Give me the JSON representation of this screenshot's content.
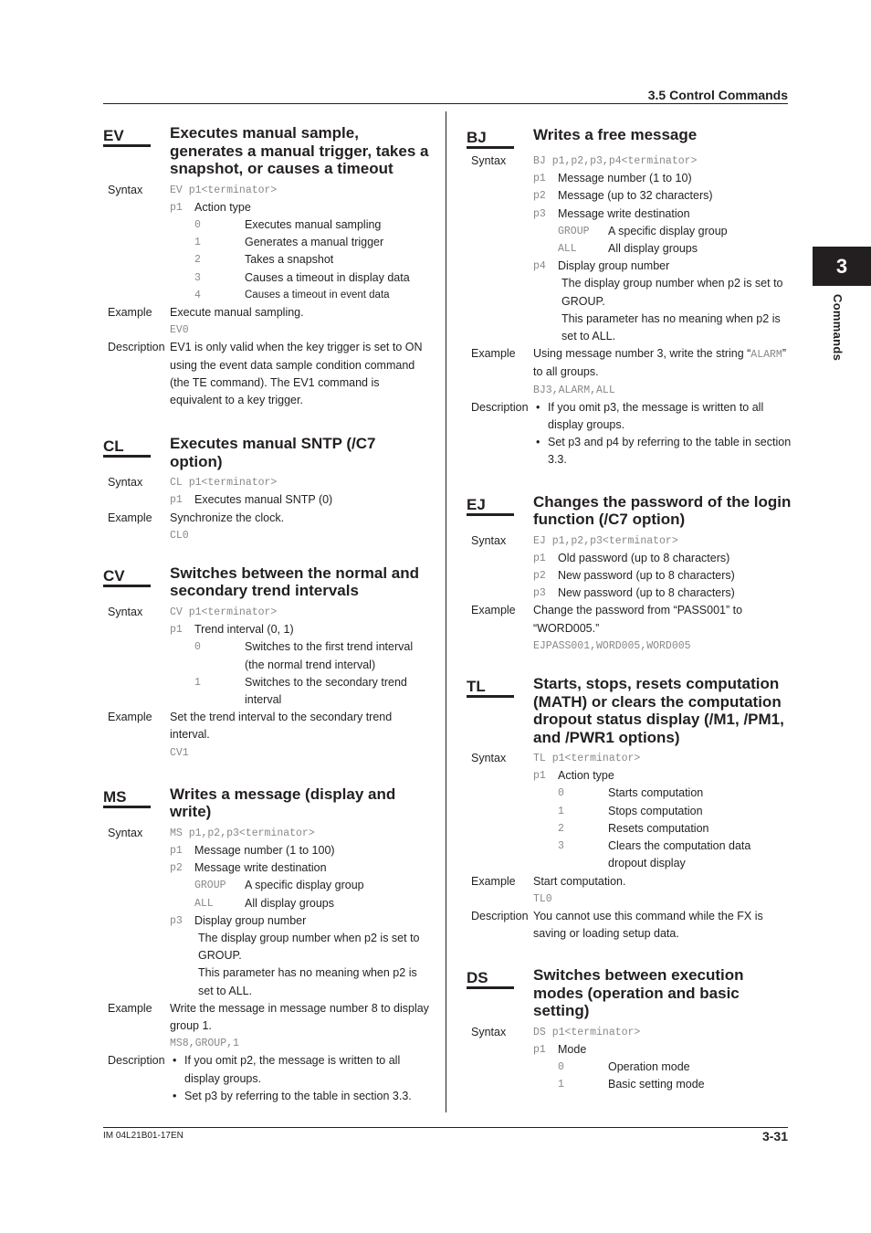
{
  "header": {
    "section_title": "3.5  Control Commands"
  },
  "chapter_tab": {
    "number": "3",
    "label": "Commands"
  },
  "footer": {
    "doc_id": "IM 04L21B01-17EN",
    "page": "3-31"
  },
  "labels": {
    "syntax": "Syntax",
    "example": "Example",
    "description": "Description",
    "bullet": "•"
  },
  "left": {
    "ev": {
      "code": "EV",
      "title": "Executes manual sample, generates a manual trigger, takes a snapshot, or causes a timeout",
      "syntax": "EV p1<terminator>",
      "params": [
        {
          "key": "p1",
          "text": "Action type",
          "options": [
            {
              "key": "0",
              "text": "Executes manual sampling"
            },
            {
              "key": "1",
              "text": "Generates a manual trigger"
            },
            {
              "key": "2",
              "text": "Takes a snapshot"
            },
            {
              "key": "3",
              "text": "Causes a timeout in display data"
            },
            {
              "key": "4",
              "text": "Causes a timeout in event data"
            }
          ]
        }
      ],
      "example_text": "Execute manual sampling.",
      "example_code": "EV0",
      "description": "EV1 is only valid when the key trigger is set to ON using the event data sample condition command (the TE command). The EV1 command is equivalent to a key trigger."
    },
    "cl": {
      "code": "CL",
      "title": "Executes manual SNTP (/C7 option)",
      "syntax": "CL p1<terminator>",
      "params": [
        {
          "key": "p1",
          "text": "Executes manual SNTP (0)"
        }
      ],
      "example_text": "Synchronize the clock.",
      "example_code": "CL0"
    },
    "cv": {
      "code": "CV",
      "title": "Switches between the normal and secondary trend intervals",
      "syntax": "CV p1<terminator>",
      "params": [
        {
          "key": "p1",
          "text": "Trend interval (0, 1)",
          "options": [
            {
              "key": "0",
              "text": "Switches to the first trend interval (the normal trend interval)"
            },
            {
              "key": "1",
              "text": "Switches to the secondary trend interval"
            }
          ]
        }
      ],
      "example_text": "Set the trend interval to the secondary trend interval.",
      "example_code": "CV1"
    },
    "ms": {
      "code": "MS",
      "title": "Writes a message (display and write)",
      "syntax": "MS p1,p2,p3<terminator>",
      "params": [
        {
          "key": "p1",
          "text": "Message number (1 to 100)"
        },
        {
          "key": "p2",
          "text": "Message write destination",
          "options": [
            {
              "key": "GROUP",
              "text": "A specific display group"
            },
            {
              "key": "ALL",
              "text": "All display groups"
            }
          ]
        },
        {
          "key": "p3",
          "text": "Display group number",
          "notes": [
            "The display group number when p2 is set to GROUP.",
            "This parameter has no meaning when p2 is set to ALL."
          ]
        }
      ],
      "example_text": "Write the message in message number 8 to display group 1.",
      "example_code": "MS8,GROUP,1",
      "description_bullets": [
        "If you omit p2, the message is written to all display groups.",
        "Set p3 by referring to the table in section 3.3."
      ]
    }
  },
  "right": {
    "bj": {
      "code": "BJ",
      "title": "Writes a free message",
      "syntax": "BJ p1,p2,p3,p4<terminator>",
      "params": [
        {
          "key": "p1",
          "text": "Message number (1 to 10)"
        },
        {
          "key": "p2",
          "text": "Message (up to 32 characters)"
        },
        {
          "key": "p3",
          "text": "Message write destination",
          "options": [
            {
              "key": "GROUP",
              "text": "A specific display group"
            },
            {
              "key": "ALL",
              "text": "All display groups"
            }
          ]
        },
        {
          "key": "p4",
          "text": "Display group number",
          "notes": [
            "The display group number when p2 is set to GROUP.",
            "This parameter has no meaning when p2 is set to ALL."
          ]
        }
      ],
      "example_text_pre": "Using message number 3, write the string “",
      "example_text_code": "ALARM",
      "example_text_post": "” to all groups.",
      "example_code": "BJ3,ALARM,ALL",
      "description_bullets": [
        "If you omit p3, the message is written to all display groups.",
        "Set p3 and p4 by referring to the table in section 3.3."
      ]
    },
    "ej": {
      "code": "EJ",
      "title": "Changes the password of the login function (/C7 option)",
      "syntax": "EJ p1,p2,p3<terminator>",
      "params": [
        {
          "key": "p1",
          "text": "Old password (up to 8 characters)"
        },
        {
          "key": "p2",
          "text": "New password (up to 8 characters)"
        },
        {
          "key": "p3",
          "text": "New password (up to 8 characters)"
        }
      ],
      "example_text": "Change the password from “PASS001” to “WORD005.”",
      "example_code": "EJPASS001,WORD005,WORD005"
    },
    "tl": {
      "code": "TL",
      "title": "Starts, stops, resets computation (MATH) or clears the computation dropout status display (/M1, /PM1, and /PWR1 options)",
      "syntax": "TL p1<terminator>",
      "params": [
        {
          "key": "p1",
          "text": "Action type",
          "options": [
            {
              "key": "0",
              "text": "Starts computation"
            },
            {
              "key": "1",
              "text": "Stops computation"
            },
            {
              "key": "2",
              "text": "Resets computation"
            },
            {
              "key": "3",
              "text": "Clears the computation data dropout display"
            }
          ]
        }
      ],
      "example_text": "Start computation.",
      "example_code": "TL0",
      "description": "You cannot use this command while the FX is saving or loading setup data."
    },
    "ds": {
      "code": "DS",
      "title": "Switches between execution modes (operation and basic setting)",
      "syntax": "DS p1<terminator>",
      "params": [
        {
          "key": "p1",
          "text": "Mode",
          "options": [
            {
              "key": "0",
              "text": "Operation mode"
            },
            {
              "key": "1",
              "text": "Basic setting mode"
            }
          ]
        }
      ]
    }
  }
}
